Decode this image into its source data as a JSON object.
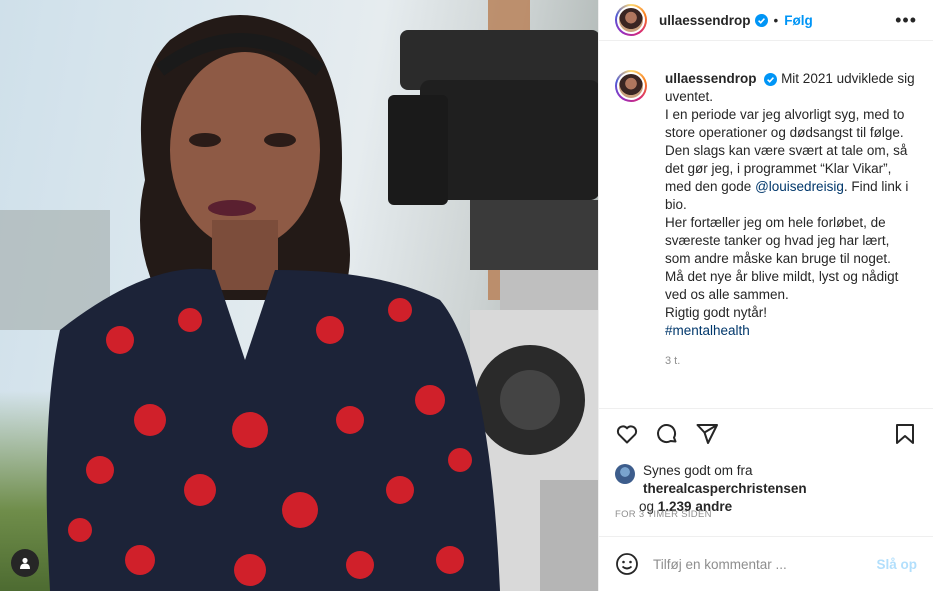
{
  "post": {
    "username": "ullaessendrop",
    "follow_label": "Følg",
    "dot": "•",
    "more": "•••",
    "caption_intro": "Mit 2021 udviklede sig uventet.",
    "caption_p1": "I en periode var jeg alvorligt syg, med to store operationer og dødsangst til følge.",
    "caption_p2_a": "Den slags kan være svært at tale om, så det gør jeg, i programmet “Klar Vikar”, med den gode ",
    "caption_mention": "@louisedreisig",
    "caption_p2_b": ". Find link i bio.",
    "caption_p3": "Her fortæller jeg om hele forløbet, de sværeste tanker og hvad jeg har lært, som andre måske kan bruge til noget.",
    "caption_p4": "Må det nye år blive mildt, lyst og nådigt ved os alle sammen.",
    "caption_p5": "Rigtig godt nytår!",
    "hashtag": "#mentalhealth",
    "caption_time": "3 t.",
    "likes_prefix": "Synes godt om fra ",
    "likes_user": "therealcasperchristensen",
    "likes_and": " og ",
    "likes_count": "1.239 andre",
    "posted_ago": "FOR 3 TIMER SIDEN",
    "comment_placeholder": "Tilføj en kommentar ...",
    "post_button": "Slå op"
  },
  "colors": {
    "accent": "#0095f6",
    "link": "#00376b",
    "muted": "#8e8e8e",
    "post_disabled": "#b2dffc"
  }
}
